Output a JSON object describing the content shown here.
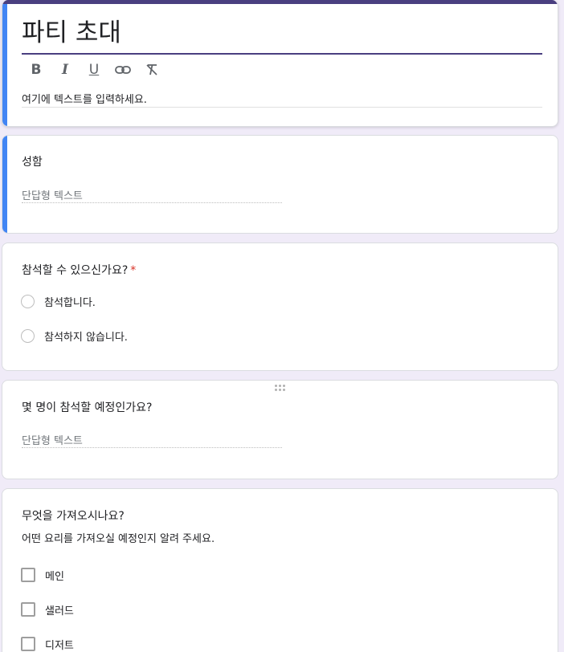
{
  "form": {
    "title": "파티 초대",
    "description_placeholder": "여기에 텍스트를 입력하세요.",
    "toolbar": [
      {
        "name": "bold",
        "glyph": "B"
      },
      {
        "name": "italic",
        "glyph": "I"
      },
      {
        "name": "underline",
        "glyph": "U"
      },
      {
        "name": "link",
        "glyph": "link-icon"
      },
      {
        "name": "clear-format",
        "glyph": "clear-format-icon"
      }
    ],
    "colors": {
      "accent": "#4a3f80",
      "active_bar": "#4285f4",
      "background": "#f0ebf8",
      "required": "#d93025"
    }
  },
  "questions": [
    {
      "title": "성함",
      "type": "short_answer",
      "placeholder": "단답형 텍스트"
    },
    {
      "title": "참석할 수 있으신가요?",
      "required_mark": "*",
      "type": "radio",
      "options": [
        "참석합니다.",
        "참석하지 않습니다."
      ]
    },
    {
      "title": "몇 명이 참석할 예정인가요?",
      "type": "short_answer",
      "placeholder": "단답형 텍스트"
    },
    {
      "title": "무엇을 가져오시나요?",
      "description": "어떤 요리를 가져오실 예정인지 알려 주세요.",
      "type": "checkbox",
      "options": [
        "메인",
        "샐러드",
        "디저트"
      ]
    }
  ]
}
